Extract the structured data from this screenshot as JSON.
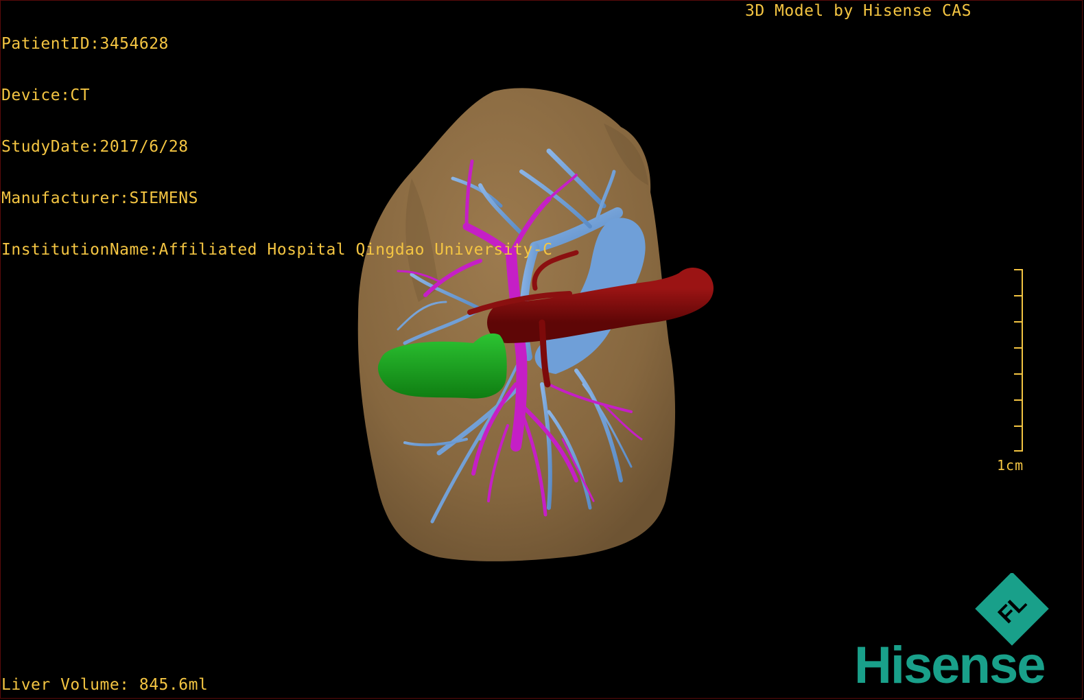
{
  "overlay": {
    "patient_id": "PatientID:3454628",
    "device": "Device:CT",
    "study_date": "StudyDate:2017/6/28",
    "manufacturer": "Manufacturer:SIEMENS",
    "institution": "InstitutionName:Affiliated Hospital Qingdao University-C",
    "model_title": "3D Model by Hisense CAS",
    "liver_volume": "Liver Volume: 845.6ml"
  },
  "scale": {
    "label": "1cm"
  },
  "logo": {
    "brand": "Hisense",
    "emblem": "FL"
  },
  "colors": {
    "overlay_text": "#f4c542",
    "liver": "#8a6b43",
    "hepatic_vein": "#6f9fd8",
    "portal_vein": "#c51fc6",
    "artery": "#7d0a0a",
    "gallbladder": "#19a01e",
    "brand": "#19a08a"
  }
}
